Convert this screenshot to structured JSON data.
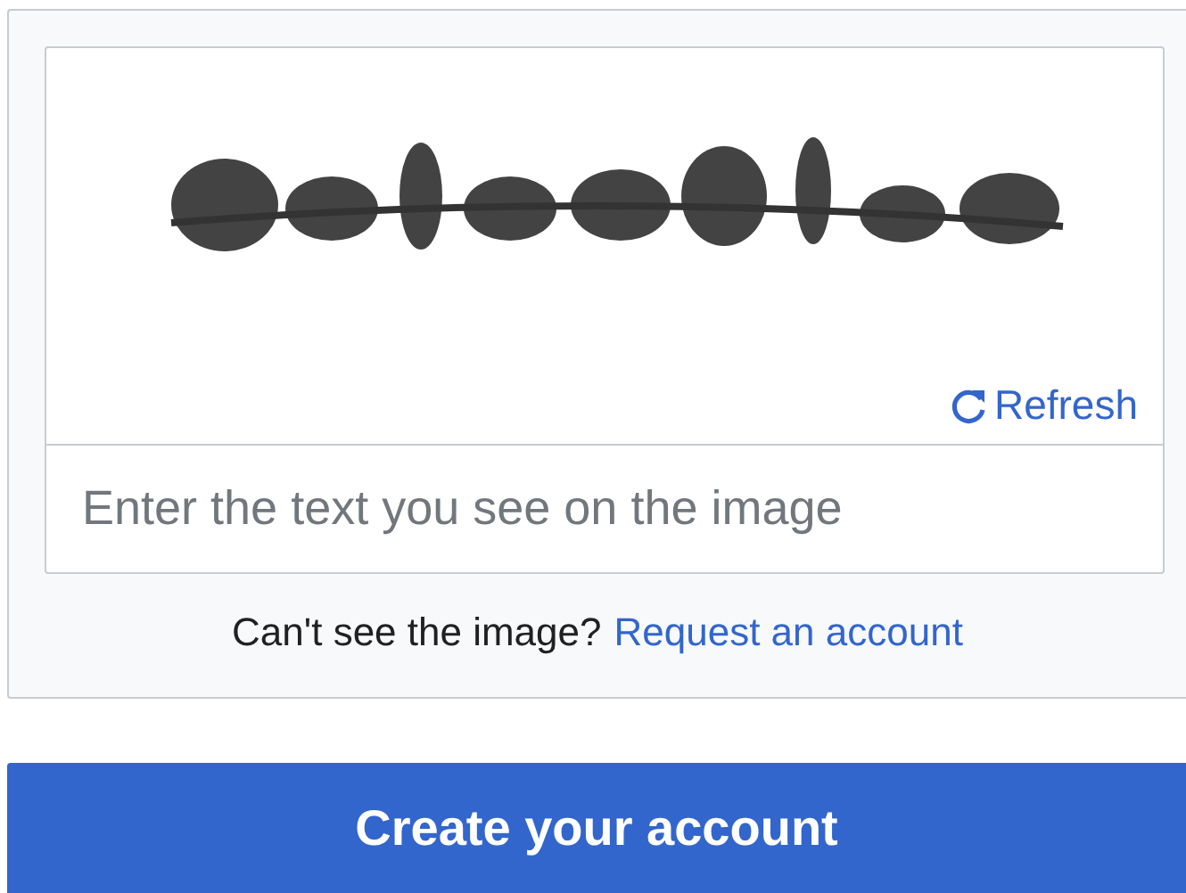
{
  "captcha": {
    "refresh": "Refresh",
    "input": {
      "placeholder": "Enter the text you see on the image"
    }
  },
  "help": {
    "text": "Can't see the image?",
    "link": "Request an account"
  },
  "submit": "Create your account"
}
